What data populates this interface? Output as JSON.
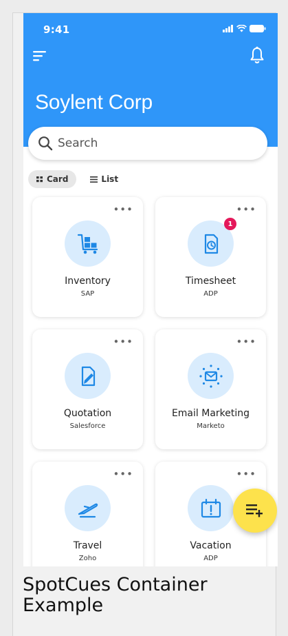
{
  "status_bar": {
    "time": "9:41"
  },
  "header": {
    "title": "Soylent Corp",
    "color": "#2f96f9"
  },
  "search": {
    "placeholder": "Search"
  },
  "view_toggle": {
    "card_label": "Card",
    "list_label": "List",
    "selected": "Card"
  },
  "cards": [
    {
      "name": "Inventory",
      "vendor": "SAP",
      "icon": "inventory-cart-icon",
      "badge": ""
    },
    {
      "name": "Timesheet",
      "vendor": "ADP",
      "icon": "timesheet-icon",
      "badge": "1"
    },
    {
      "name": "Quotation",
      "vendor": "Salesforce",
      "icon": "quotation-document-icon",
      "badge": ""
    },
    {
      "name": "Email Marketing",
      "vendor": "Marketo",
      "icon": "email-marketing-icon",
      "badge": ""
    },
    {
      "name": "Travel",
      "vendor": "Zoho",
      "icon": "travel-plane-icon",
      "badge": ""
    },
    {
      "name": "Vacation",
      "vendor": "ADP",
      "icon": "vacation-calendar-icon",
      "badge": ""
    }
  ],
  "card_menu_glyph": "•••",
  "fab": {
    "icon": "add-to-list-icon",
    "color": "#fde24c"
  },
  "caption": {
    "text": "SpotCues Container Example"
  },
  "colors": {
    "accent": "#2f96f9",
    "icon_bg": "#d9ecfd",
    "badge": "#e4185a"
  }
}
